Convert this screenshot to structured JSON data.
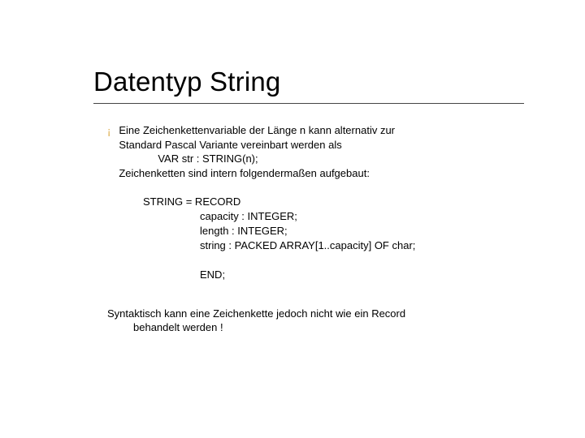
{
  "slide": {
    "title": "Datentyp String",
    "bullet_glyph": "¡",
    "intro": {
      "line1": "Eine Zeichenkettenvariable der Länge n kann alternativ zur",
      "line2": "Standard Pascal Variante vereinbart werden als",
      "var_line": "VAR str : STRING(n);",
      "line3": "Zeichenketten sind intern folgendermaßen aufgebaut:"
    },
    "code": {
      "l1": "STRING = RECORD",
      "l2": "capacity : INTEGER;",
      "l3": "length : INTEGER;",
      "l4": "string : PACKED ARRAY[1..capacity] OF char;",
      "l5_blank": " ",
      "l6": "END;"
    },
    "note": {
      "line1": "Syntaktisch kann eine Zeichenkette jedoch nicht wie ein Record",
      "line2": "behandelt werden !"
    }
  }
}
